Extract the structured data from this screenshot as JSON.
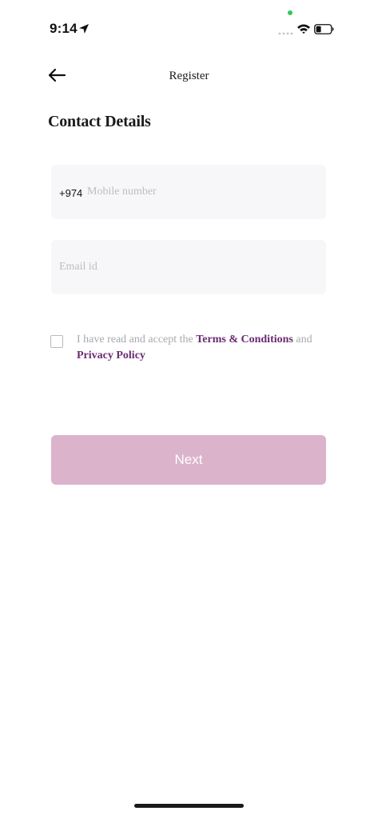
{
  "status_bar": {
    "time": "9:14",
    "location_icon": "location-arrow-icon",
    "signal_icon": "cellular-signal-icon",
    "wifi_icon": "wifi-icon",
    "battery_icon": "battery-icon",
    "privacy_dot_color": "#34c759"
  },
  "header": {
    "back_icon": "arrow-left-icon",
    "title": "Register"
  },
  "section": {
    "heading": "Contact Details"
  },
  "form": {
    "country_code": "+974",
    "mobile_placeholder": "Mobile number",
    "mobile_value": "",
    "email_placeholder": "Email id",
    "email_value": ""
  },
  "terms": {
    "checked": false,
    "prefix": "I have read and accept the ",
    "terms_link": "Terms & Conditions",
    "middle": " and",
    "privacy_link": "Privacy Policy",
    "link_color": "#6b2a73"
  },
  "actions": {
    "next_label": "Next",
    "next_color": "#dbb3cb"
  }
}
